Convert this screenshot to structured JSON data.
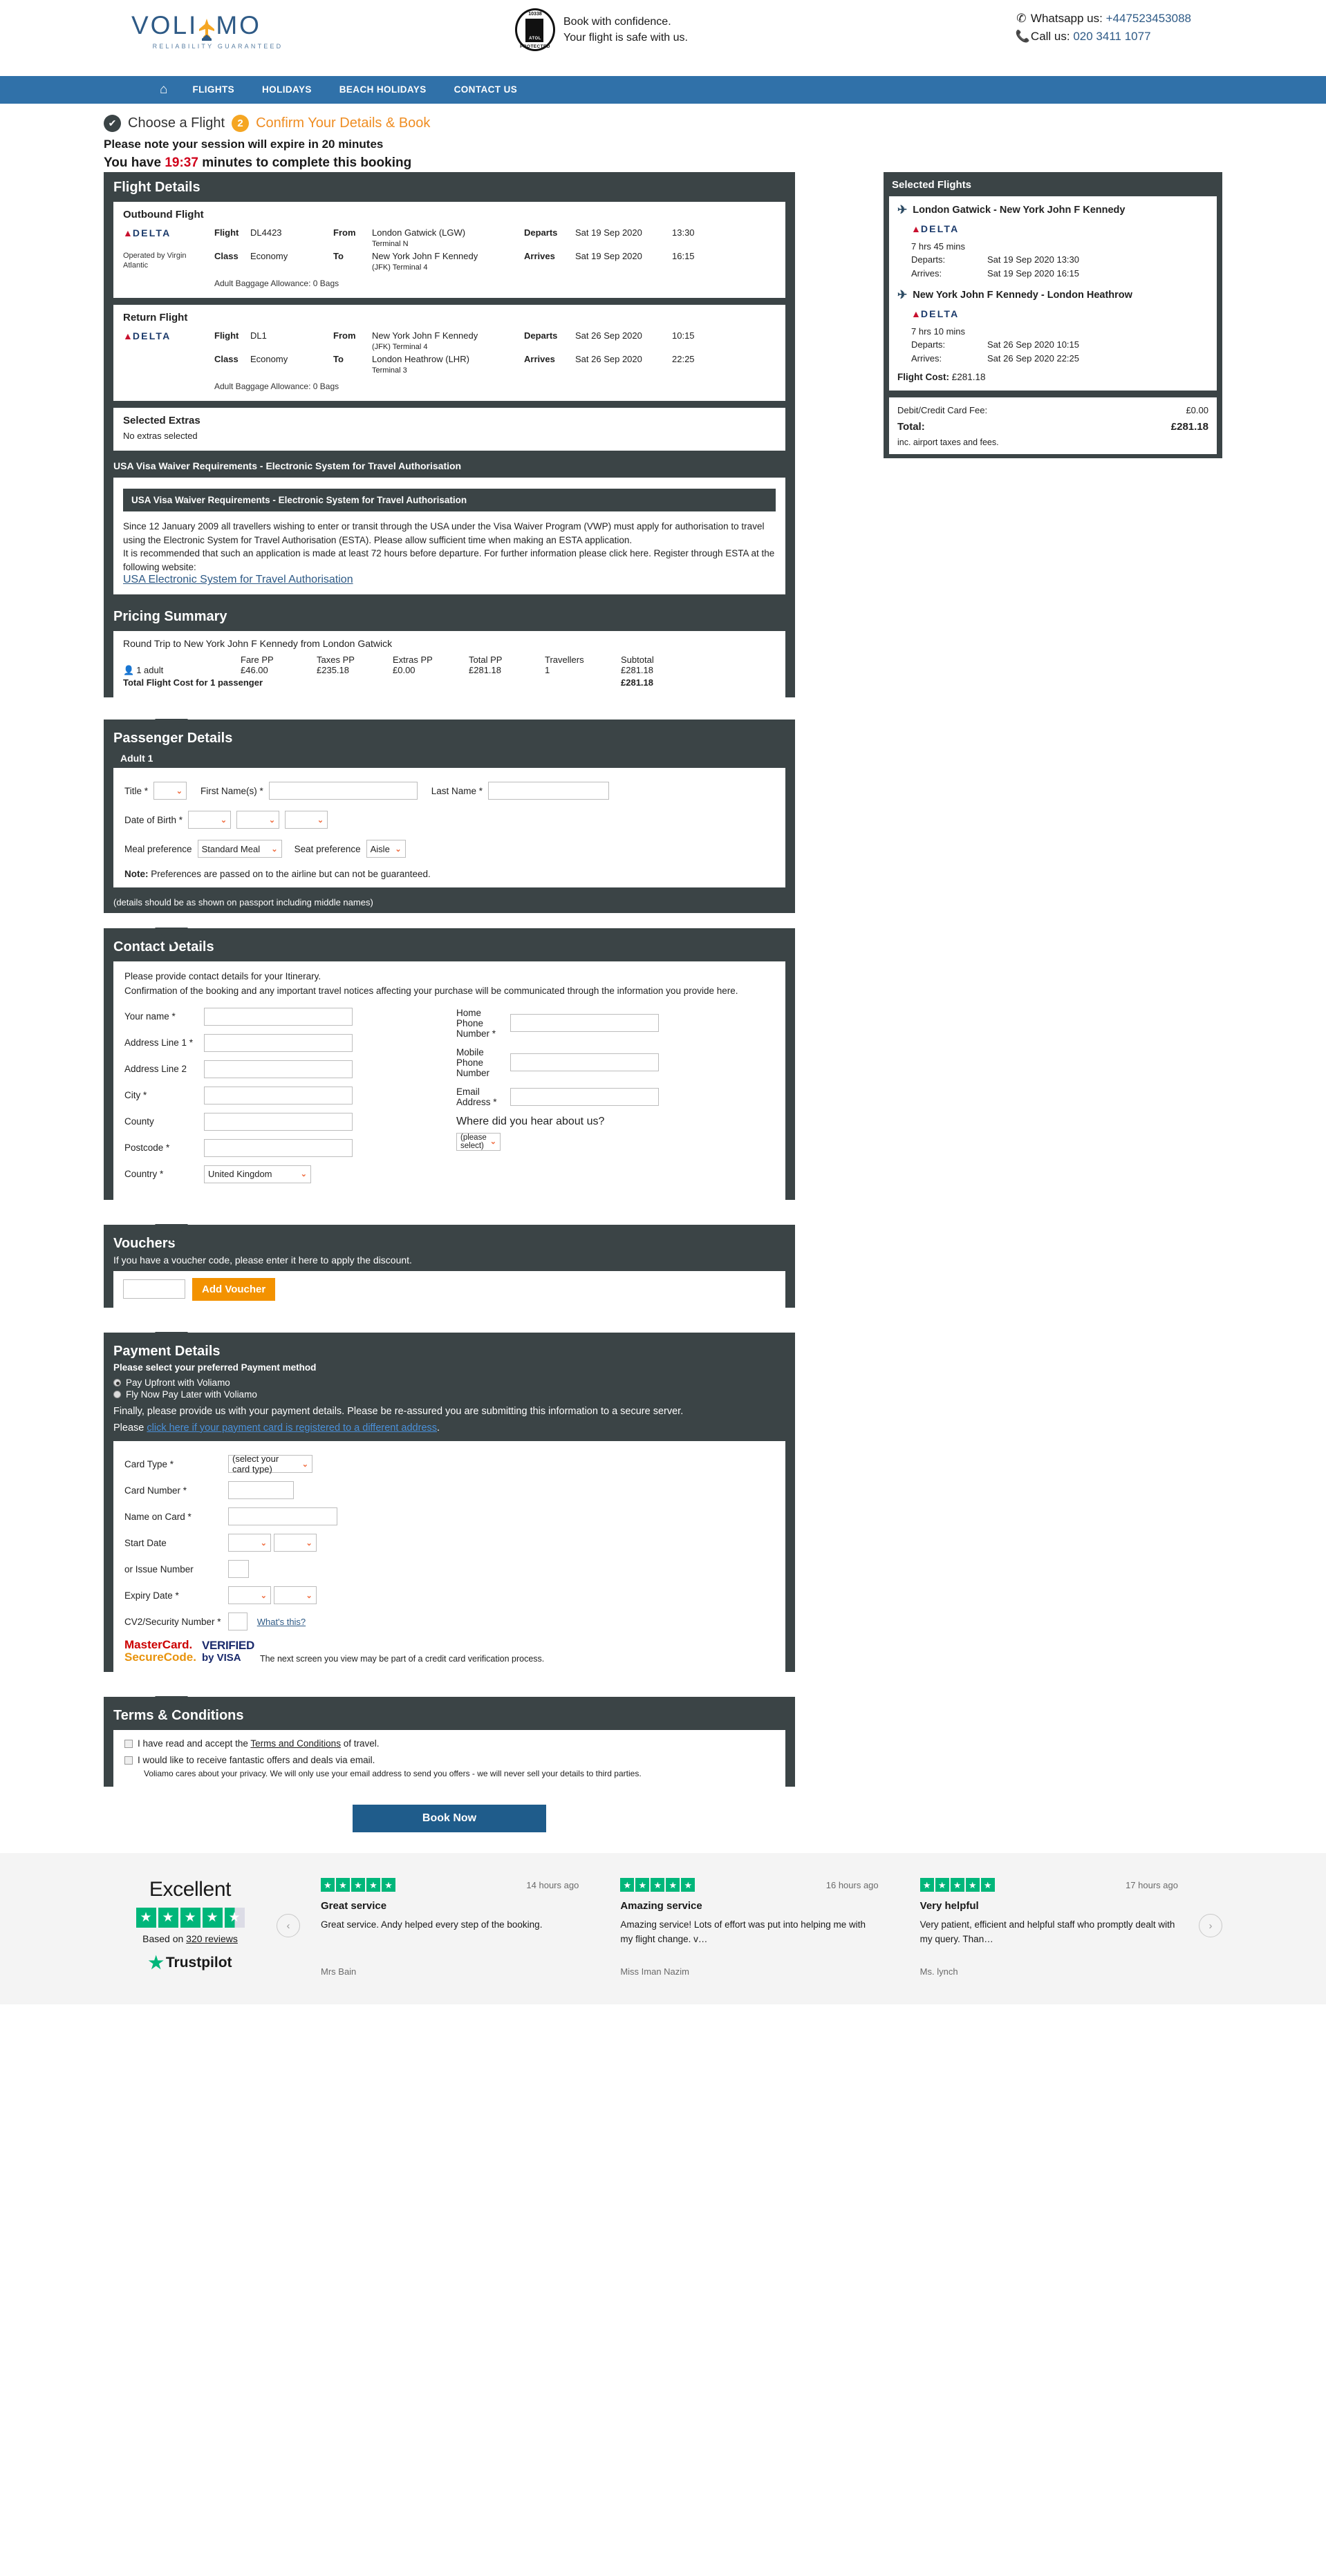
{
  "header": {
    "logo_word_left": "VOLI",
    "logo_word_right": "MO",
    "logo_tagline": "RELIABILITY GUARANTEED",
    "atol_number": "10338",
    "atol_label": "ATOL",
    "atol_protected": "PROTECTED",
    "atol_line1": "Book with confidence.",
    "atol_line2": "Your flight is safe with us.",
    "whatsapp_label": "Whatsapp us:",
    "whatsapp_number": "+447523453088",
    "call_label": "Call us:",
    "call_number": "020 3411 1077"
  },
  "nav": {
    "home_icon": "home-icon",
    "items": [
      {
        "label": "FLIGHTS"
      },
      {
        "label": "HOLIDAYS"
      },
      {
        "label": "BEACH HOLIDAYS"
      },
      {
        "label": "CONTACT US"
      }
    ]
  },
  "steps": {
    "step1_label": "Choose a Flight",
    "step1_icon": "check-icon",
    "step2_number": "2",
    "step2_label": "Confirm Your Details & Book",
    "session_line1": "Please note your session will expire in 20 minutes",
    "session_prefix": "You have ",
    "session_timer": "19:37",
    "session_suffix": " minutes to complete this booking"
  },
  "flight_details": {
    "title": "Flight Details",
    "outbound": {
      "heading": "Outbound Flight",
      "airline": "DELTA",
      "operated_by": "Operated by Virgin Atlantic",
      "flight_label": "Flight",
      "flight_number": "DL4423",
      "from_label": "From",
      "from_value": "London Gatwick (LGW)",
      "from_terminal": "Terminal N",
      "departs_label": "Departs",
      "departs_date": "Sat 19 Sep 2020",
      "departs_time": "13:30",
      "class_label": "Class",
      "class_value": "Economy",
      "to_label": "To",
      "to_value": "New York John F Kennedy",
      "to_terminal": "(JFK) Terminal 4",
      "arrives_label": "Arrives",
      "arrives_date": "Sat 19 Sep 2020",
      "arrives_time": "16:15",
      "baggage": "Adult Baggage Allowance: 0 Bags"
    },
    "return": {
      "heading": "Return Flight",
      "airline": "DELTA",
      "flight_label": "Flight",
      "flight_number": "DL1",
      "from_label": "From",
      "from_value": "New York John F Kennedy",
      "from_terminal": "(JFK) Terminal 4",
      "departs_label": "Departs",
      "departs_date": "Sat 26 Sep 2020",
      "departs_time": "10:15",
      "class_label": "Class",
      "class_value": "Economy",
      "to_label": "To",
      "to_value": "London Heathrow (LHR)",
      "to_terminal": "Terminal 3",
      "arrives_label": "Arrives",
      "arrives_date": "Sat 26 Sep 2020",
      "arrives_time": "22:25",
      "baggage": "Adult Baggage Allowance: 0 Bags"
    },
    "extras": {
      "heading": "Selected Extras",
      "value": "No extras selected"
    }
  },
  "visa": {
    "panel_title": "USA Visa Waiver Requirements - Electronic System for Travel Authorisation",
    "inner_title": "USA Visa Waiver Requirements - Electronic System for Travel Authorisation",
    "para1": "Since 12 January 2009 all travellers wishing to enter or transit through the USA under the Visa Waiver Program (VWP) must apply for authorisation to travel using the Electronic System for Travel Authorisation (ESTA). Please allow sufficient time when making an ESTA application.",
    "para2": "It is recommended that such an application is made at least 72 hours before departure. For further information please click here. Register through ESTA at the following website:",
    "link": "USA Electronic System for Travel Authorisation"
  },
  "pricing": {
    "title": "Pricing Summary",
    "trip_title": "Round Trip to New York John F Kennedy from London Gatwick",
    "headers": [
      "",
      "Fare PP",
      "Taxes PP",
      "Extras PP",
      "Total PP",
      "Travellers",
      "Subtotal"
    ],
    "row": {
      "pax_icon": "passenger-icon",
      "pax": "1 adult",
      "fare_pp": "£46.00",
      "taxes_pp": "£235.18",
      "extras_pp": "£0.00",
      "total_pp": "£281.18",
      "travellers": "1",
      "subtotal": "£281.18"
    },
    "total_label": "Total Flight Cost for 1 passenger",
    "total_value": "£281.18"
  },
  "selected_flights": {
    "title": "Selected Flights",
    "legs": [
      {
        "route": "London Gatwick - New York John F Kennedy",
        "direction_icon": "plane-depart-icon",
        "airline": "DELTA",
        "duration": "7 hrs 45 mins",
        "departs_label": "Departs:",
        "departs_value": "Sat 19 Sep 2020 13:30",
        "arrives_label": "Arrives:",
        "arrives_value": "Sat 19 Sep 2020 16:15"
      },
      {
        "route": "New York John F Kennedy - London Heathrow",
        "direction_icon": "plane-arrive-icon",
        "airline": "DELTA",
        "duration": "7 hrs 10 mins",
        "departs_label": "Departs:",
        "departs_value": "Sat 26 Sep 2020 10:15",
        "arrives_label": "Arrives:",
        "arrives_value": "Sat 26 Sep 2020 22:25"
      }
    ],
    "flight_cost_label": "Flight Cost:",
    "flight_cost_value": "£281.18",
    "card_fee_label": "Debit/Credit Card Fee:",
    "card_fee_value": "£0.00",
    "total_label": "Total:",
    "total_value": "£281.18",
    "total_note": "inc. airport taxes and fees."
  },
  "passenger": {
    "title": "Passenger Details",
    "subtitle": "Adult 1",
    "title_label": "Title *",
    "title_value": "",
    "first_name_label": "First Name(s) *",
    "first_name_value": "",
    "last_name_label": "Last Name *",
    "last_name_value": "",
    "dob_label": "Date of Birth *",
    "dob_day": "",
    "dob_month": "",
    "dob_year": "",
    "meal_label": "Meal preference",
    "meal_value": "Standard Meal",
    "seat_label": "Seat preference",
    "seat_value": "Aisle",
    "note_bold": "Note:",
    "note_text": " Preferences are passed on to the airline but can not be guaranteed.",
    "footer_note": "(details should be as shown on passport including middle names)"
  },
  "contact": {
    "title": "Contact Details",
    "intro_line1": "Please provide contact details for your Itinerary.",
    "intro_line2": "Confirmation of the booking and any important travel notices affecting your purchase will be communicated through the information you provide here.",
    "your_name_label": "Your name *",
    "your_name_value": "",
    "address1_label": "Address Line 1 *",
    "address1_value": "",
    "address2_label": "Address Line 2",
    "address2_value": "",
    "city_label": "City *",
    "city_value": "",
    "county_label": "County",
    "county_value": "",
    "postcode_label": "Postcode *",
    "postcode_value": "",
    "country_label": "Country *",
    "country_value": "United Kingdom",
    "home_phone_label": "Home Phone Number *",
    "home_phone_value": "",
    "mobile_label": "Mobile Phone Number",
    "mobile_value": "",
    "email_label": "Email Address *",
    "email_value": "",
    "hear_label": "Where did you hear about us?",
    "hear_value": "(please select)"
  },
  "vouchers": {
    "title": "Vouchers",
    "subtitle": "If you have a voucher code, please enter it here to apply the discount.",
    "input_value": "",
    "button_label": "Add Voucher"
  },
  "payment": {
    "title": "Payment Details",
    "subtitle": "Please select your preferred Payment method",
    "option1": "Pay Upfront with Voliamo",
    "option2": "Fly Now Pay Later with Voliamo",
    "para": "Finally, please provide us with your payment details. Please be re-assured you are submitting this information to a secure server.",
    "please_prefix": "Please ",
    "different_address_link": "click here if your payment card is registered to a different address",
    "card_type_label": "Card Type *",
    "card_type_value": "(select your card type)",
    "card_number_label": "Card Number *",
    "card_number_value": "",
    "name_on_card_label": "Name on Card *",
    "name_on_card_value": "",
    "start_date_label": "Start Date",
    "start_date_month": "",
    "start_date_year": "",
    "issue_number_label": "or Issue Number",
    "issue_number_value": "",
    "expiry_label": "Expiry Date *",
    "expiry_month": "",
    "expiry_year": "",
    "cv2_label": "CV2/Security Number *",
    "cv2_value": "",
    "whats_this": "What's this?",
    "mastercard_l1": "MasterCard.",
    "mastercard_l2": "SecureCode.",
    "visa_l1": "VERIFIED",
    "visa_l2": "by VISA",
    "verify_note": "The next screen you view may be part of a credit card verification process."
  },
  "terms": {
    "title": "Terms & Conditions",
    "accept_prefix": "I have read and accept the ",
    "accept_link": "Terms and Conditions",
    "accept_suffix": " of travel.",
    "offers_label": "I would like to receive fantastic offers and deals via email.",
    "privacy_note": "Voliamo cares about your privacy. We will only use your email address to send you offers - we will never sell your details to third parties.",
    "book_button": "Book Now"
  },
  "trustpilot": {
    "rating_word": "Excellent",
    "stars": 4.5,
    "based_prefix": "Based on ",
    "based_count": "320 reviews",
    "brand": "Trustpilot",
    "prev_icon": "chevron-left-icon",
    "next_icon": "chevron-right-icon",
    "reviews": [
      {
        "stars": 5,
        "ago": "14 hours ago",
        "title": "Great service",
        "body": "Great service. Andy helped every step of the booking.",
        "author": "Mrs Bain"
      },
      {
        "stars": 5,
        "ago": "16 hours ago",
        "title": "Amazing service",
        "body": "Amazing service! Lots of effort was put into helping me with my flight change. v…",
        "author": "Miss Iman Nazim"
      },
      {
        "stars": 5,
        "ago": "17 hours ago",
        "title": "Very helpful",
        "body": "Very patient, efficient and helpful staff who promptly dealt with my query. Than…",
        "author": "Ms. lynch"
      }
    ]
  },
  "colors": {
    "nav": "#3071a9",
    "panel": "#3b4446",
    "accent_orange": "#f39200",
    "book_blue": "#1f5c8b",
    "timer_red": "#d0021b",
    "trustpilot_green": "#00b67a"
  }
}
